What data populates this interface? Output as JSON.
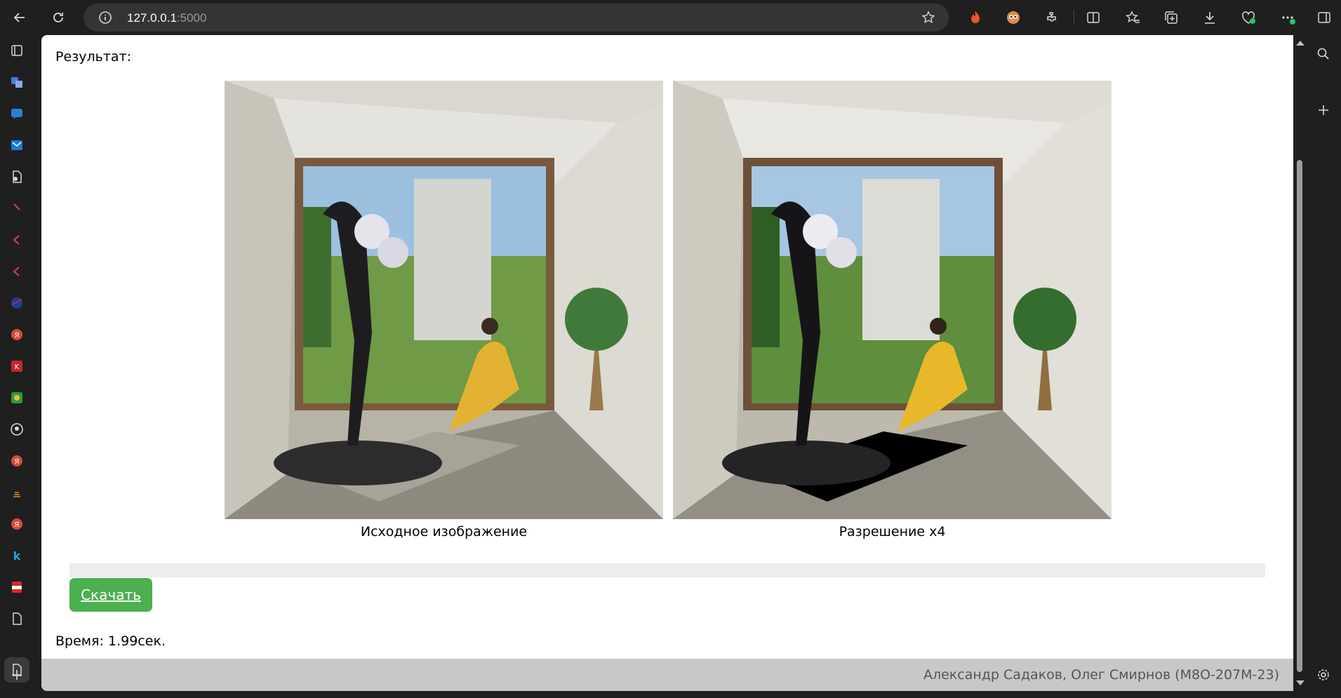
{
  "browser": {
    "url_host": "127.0.0.1",
    "url_port": ":5000"
  },
  "page": {
    "result_label": "Результат:",
    "images": [
      {
        "caption": "Исходное изображение"
      },
      {
        "caption": "Разрешение x4"
      }
    ],
    "progress_percent": 0,
    "download_label": "Скачать",
    "time_label": "Время:",
    "time_value": "1.99сек.",
    "footer_text": "Александр Садаков, Олег Смирнов (М8О-207М-23)"
  },
  "colors": {
    "download_button": "#4caf50",
    "footer_bg": "#c8c8c8",
    "footer_text": "#555555",
    "browser_chrome": "#1f1f1f"
  },
  "icons": {
    "toolbar": [
      "back-icon",
      "reload-icon",
      "info-icon",
      "favorite-star-icon",
      "extension-fire-icon",
      "extension-owl-icon",
      "extensions-icon",
      "split-screen-icon",
      "favorites-icon",
      "collections-icon",
      "downloads-icon",
      "browser-essentials-icon",
      "more-icon"
    ],
    "left_sidebar": [
      "tabs-icon",
      "translate-icon",
      "chat-icon",
      "outlook-icon",
      "doc-icon",
      "app-icon",
      "app-icon",
      "app-icon",
      "nasa-icon",
      "yandex-icon",
      "kinopoisk-icon",
      "app-icon",
      "github-icon",
      "yandex-icon",
      "stack-icon",
      "yandex-icon",
      "k-icon",
      "pdf-icon",
      "page-icon",
      "page-icon",
      "add-icon"
    ],
    "right_sidebar": [
      "search-icon",
      "add-icon",
      "settings-icon"
    ]
  }
}
